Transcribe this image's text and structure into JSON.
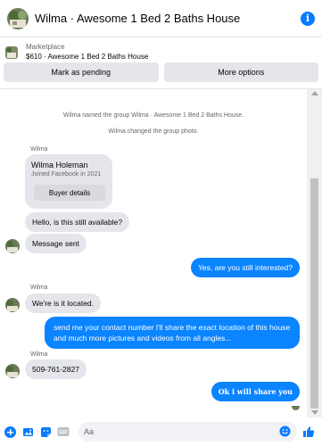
{
  "header": {
    "title": "Wilma · Awesome 1 Bed 2 Baths House",
    "info_icon": "info-icon"
  },
  "listing": {
    "label": "Marketplace",
    "price_title": "$610 · Awesome 1 Bed 2 Baths House",
    "actions": [
      "Mark as pending",
      "More options"
    ]
  },
  "conversation": {
    "system_messages": [
      "Wilma named the group Wilma · Awesome 1 Bed 2 Baths House.",
      "Wilma changed the group photo."
    ],
    "sender_name": "Wilma",
    "buyer_card": {
      "name": "Wilma Holeman",
      "joined": "Joined Facebook in 2021",
      "button": "Buyer details"
    },
    "messages": [
      {
        "from": "them",
        "text": "Hello, is this still available?"
      },
      {
        "from": "them",
        "text": "Message sent"
      },
      {
        "from": "me",
        "text": "Yes, are you still interested?"
      },
      {
        "from": "them",
        "text": "We're is it located."
      },
      {
        "from": "me",
        "text": "send me your contact number I'll share the exact location of this house and much more pictures and videos from all angles..."
      },
      {
        "from": "them",
        "text": "509-761-2827"
      },
      {
        "from": "me",
        "text": "Ok i will share you"
      }
    ]
  },
  "composer": {
    "placeholder": "Aa"
  },
  "colors": {
    "accent": "#0a84ff",
    "incoming_bubble": "#e4e6eb",
    "system_text": "#65676b"
  }
}
